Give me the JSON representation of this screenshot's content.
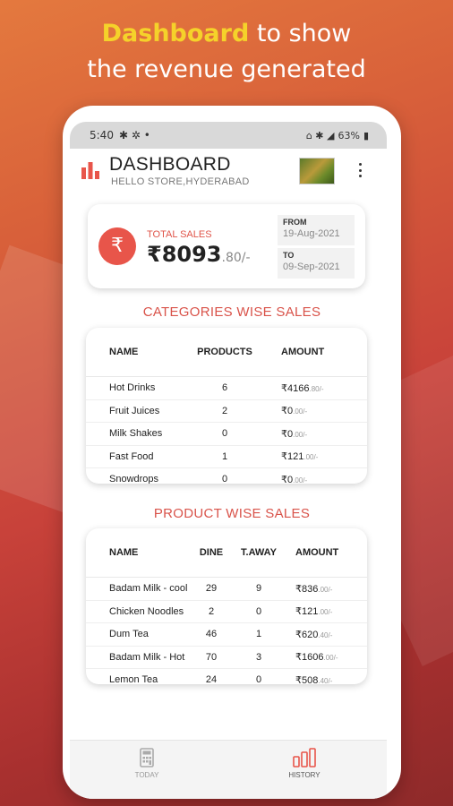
{
  "headline": {
    "highlight": "Dashboard",
    "line1_rest": " to show",
    "line2": "the revenue generated"
  },
  "status_bar": {
    "time": "5:40",
    "battery": "63%"
  },
  "app": {
    "title": "DASHBOARD",
    "subtitle": "HELLO STORE,HYDERABAD"
  },
  "total_sales": {
    "label": "TOTAL SALES",
    "currency": "₹",
    "amount": "₹8093",
    "decimal": ".80/-",
    "from_label": "FROM",
    "from_date": "19-Aug-2021",
    "to_label": "TO",
    "to_date": "09-Sep-2021"
  },
  "categories": {
    "title": "CATEGORIES WISE SALES",
    "headers": [
      "NAME",
      "PRODUCTS",
      "AMOUNT"
    ],
    "rows": [
      {
        "name": "Hot Drinks",
        "products": "6",
        "amount": "₹4166",
        "dec": ".80/-"
      },
      {
        "name": "Fruit Juices",
        "products": "2",
        "amount": "₹0",
        "dec": ".00/-"
      },
      {
        "name": "Milk Shakes",
        "products": "0",
        "amount": "₹0",
        "dec": ".00/-"
      },
      {
        "name": "Fast Food",
        "products": "1",
        "amount": "₹121",
        "dec": ".00/-"
      },
      {
        "name": "Snowdrops",
        "products": "0",
        "amount": "₹0",
        "dec": ".00/-"
      }
    ]
  },
  "products": {
    "title": "PRODUCT WISE SALES",
    "headers": [
      "NAME",
      "DINE",
      "T.AWAY",
      "AMOUNT"
    ],
    "rows": [
      {
        "name": "Badam Milk - cool",
        "dine": "29",
        "taway": "9",
        "amount": "₹836",
        "dec": ".00/-"
      },
      {
        "name": "Chicken Noodles",
        "dine": "2",
        "taway": "0",
        "amount": "₹121",
        "dec": ".00/-"
      },
      {
        "name": "Dum Tea",
        "dine": "46",
        "taway": "1",
        "amount": "₹620",
        "dec": ".40/-"
      },
      {
        "name": "Badam Milk - Hot",
        "dine": "70",
        "taway": "3",
        "amount": "₹1606",
        "dec": ".00/-"
      },
      {
        "name": "Lemon Tea",
        "dine": "24",
        "taway": "0",
        "amount": "₹508",
        "dec": ".40/-"
      }
    ]
  },
  "nav": {
    "today": "TODAY",
    "history": "HISTORY"
  },
  "colors": {
    "accent": "#e8554a",
    "highlight": "#f5d22a"
  },
  "icons": [
    "bar-chart-icon",
    "more-vert-icon",
    "rupee-icon",
    "calculator-icon",
    "history-chart-icon"
  ]
}
